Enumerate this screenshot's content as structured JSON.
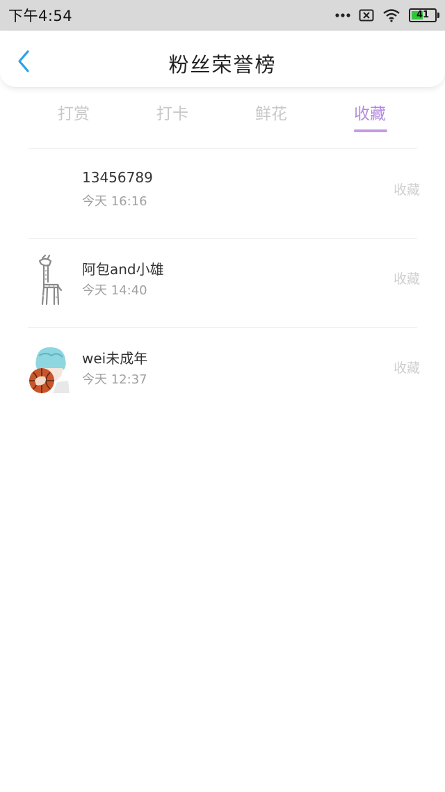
{
  "status_bar": {
    "time": "下午4:54",
    "battery": "41",
    "icons": [
      "more-dots-icon",
      "sim-x-icon",
      "wifi-icon",
      "battery-icon"
    ]
  },
  "header": {
    "back_icon": "chevron-left-icon",
    "title": "粉丝荣誉榜"
  },
  "tabs": [
    {
      "label": "打赏",
      "active": false
    },
    {
      "label": "打卡",
      "active": false
    },
    {
      "label": "鲜花",
      "active": false
    },
    {
      "label": "收藏",
      "active": true
    }
  ],
  "rows": [
    {
      "name": "13456789",
      "time": "今天 16:16",
      "action": "收藏",
      "avatar": "blank-avatar"
    },
    {
      "name": "阿包and小雄",
      "time": "今天 14:40",
      "action": "收藏",
      "avatar": "giraffe-avatar"
    },
    {
      "name": "wei未成年",
      "time": "今天 12:37",
      "action": "收藏",
      "avatar": "anime-basketball-avatar"
    }
  ],
  "colors": {
    "accent": "#b48ae0",
    "back_icon": "#2aa1e8",
    "status_bar_bg": "#d9d9d9",
    "battery_green": "#2ec73a"
  }
}
